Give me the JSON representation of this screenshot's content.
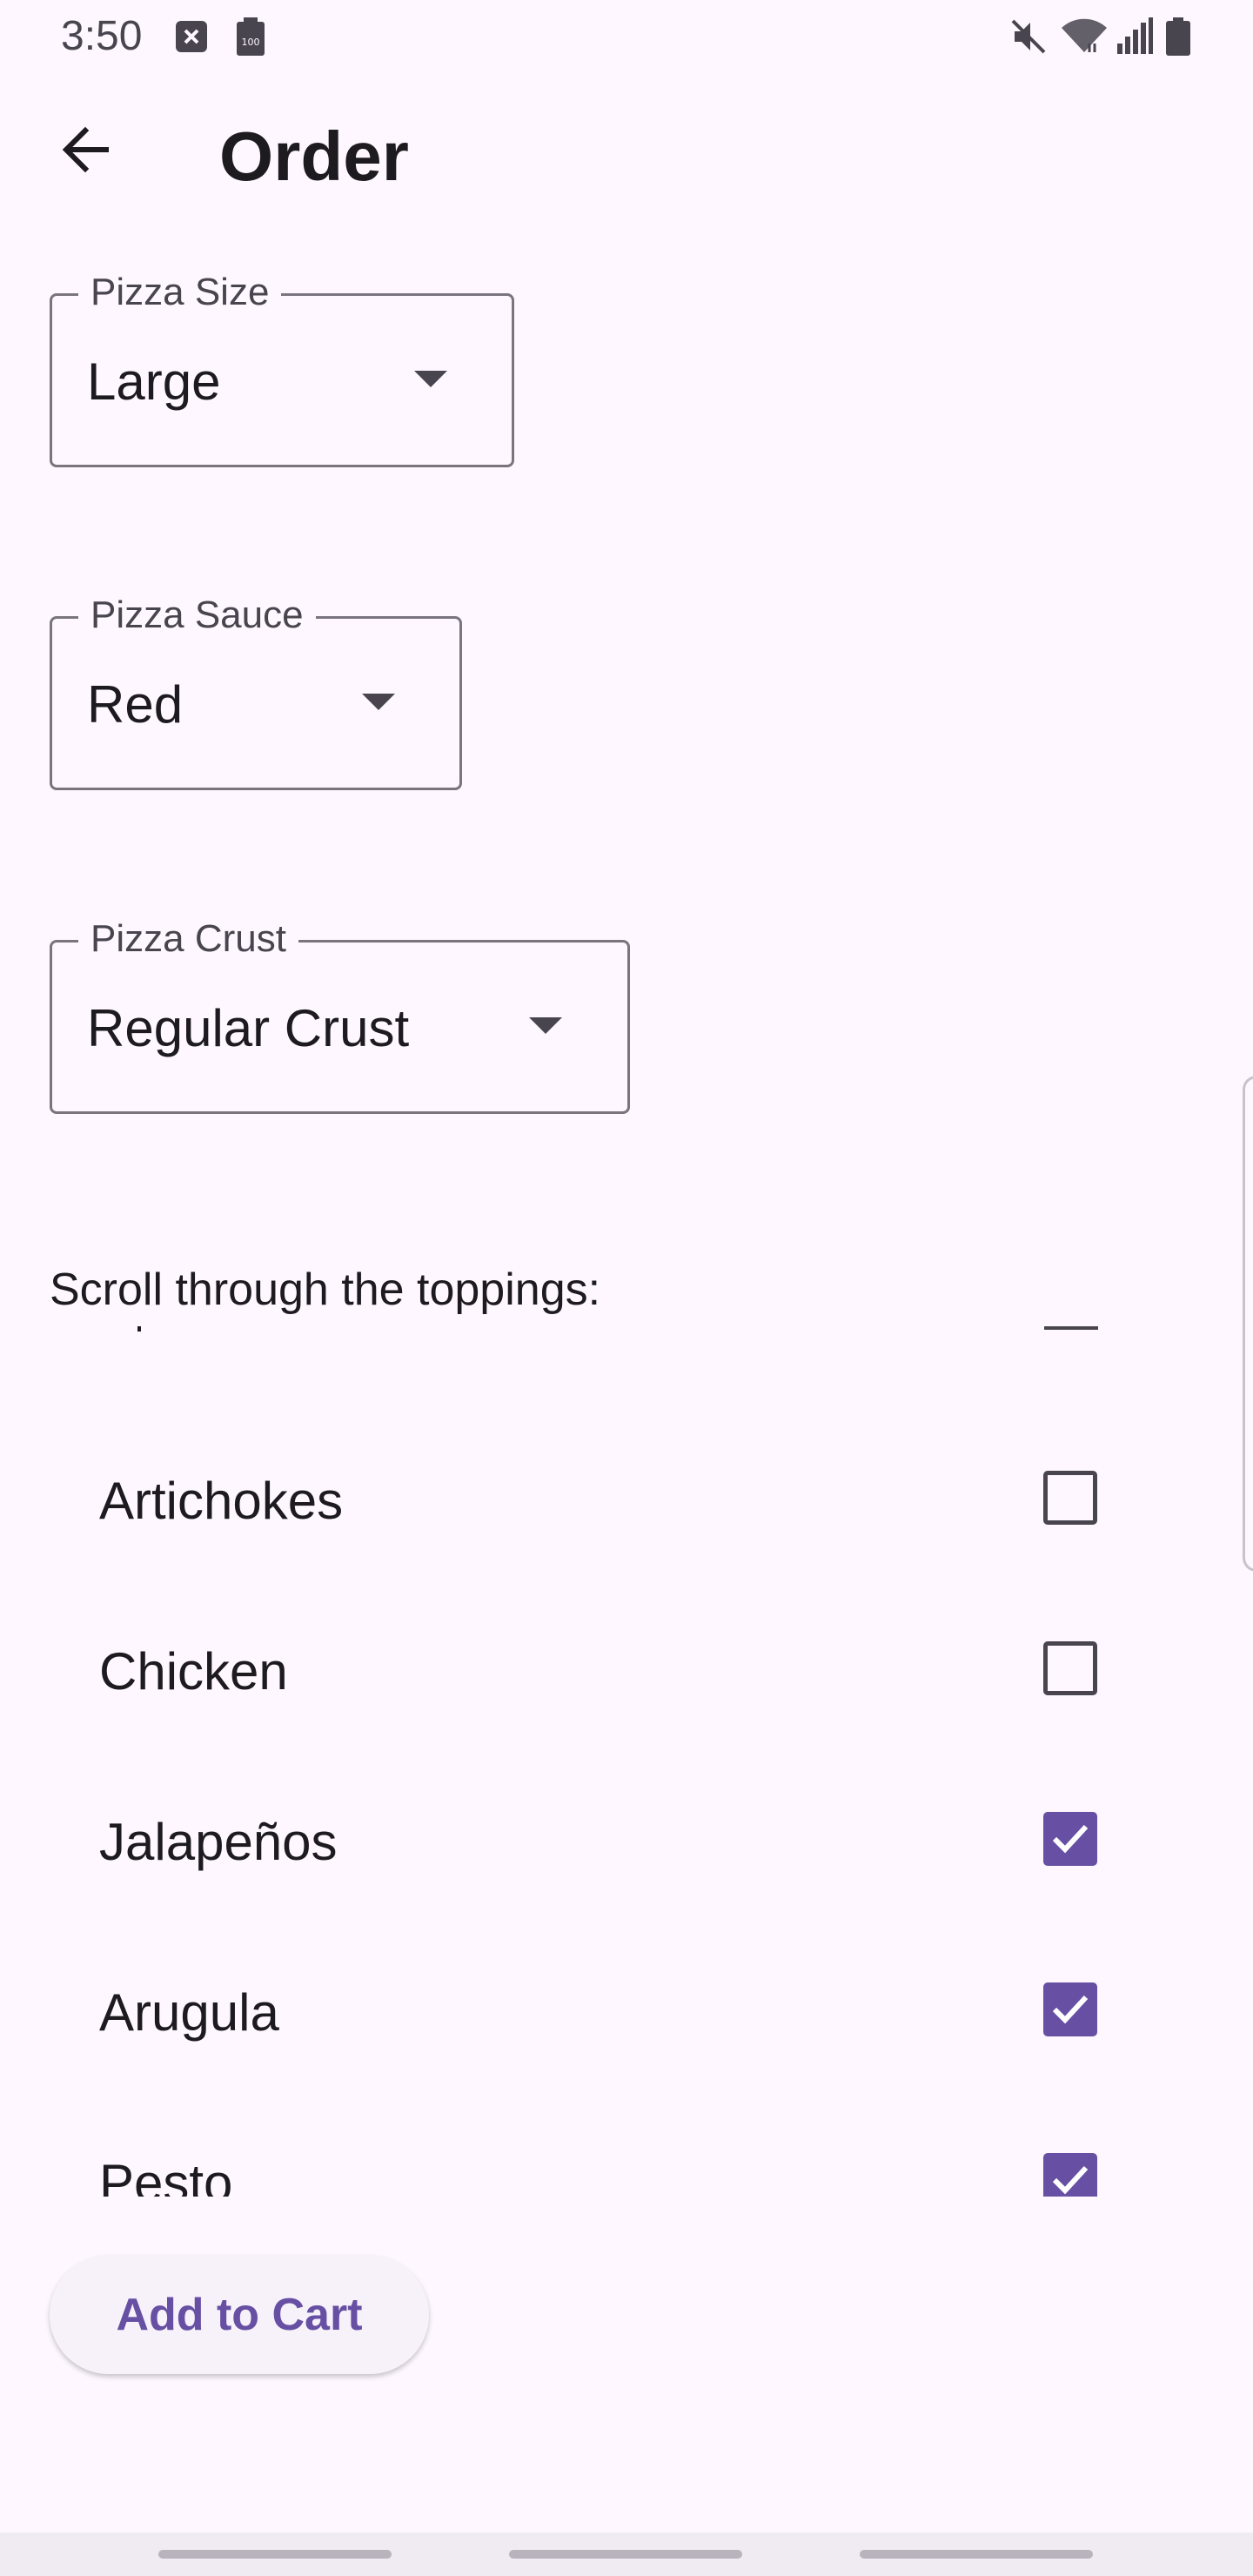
{
  "status_bar": {
    "time": "3:50",
    "left_icons": [
      "close-notification-icon",
      "battery-100-icon"
    ],
    "battery_badge": "100",
    "right_icons": [
      "mute-icon",
      "wifi-icon",
      "signal-icon",
      "battery-icon"
    ]
  },
  "app_bar": {
    "back_icon": "arrow-left-icon",
    "title": "Order"
  },
  "fields": {
    "size": {
      "label": "Pizza Size",
      "value": "Large"
    },
    "sauce": {
      "label": "Pizza Sauce",
      "value": "Red"
    },
    "crust": {
      "label": "Pizza Crust",
      "value": "Regular Crust"
    }
  },
  "toppings": {
    "heading": "Scroll through the toppings:",
    "items": [
      {
        "label": "Artichokes",
        "checked": false
      },
      {
        "label": "Chicken",
        "checked": false
      },
      {
        "label": "Jalapeños",
        "checked": true
      },
      {
        "label": "Arugula",
        "checked": true
      },
      {
        "label": "Pesto",
        "checked": true
      }
    ]
  },
  "cart_button": {
    "label": "Add to Cart"
  },
  "colors": {
    "background": "#FEF7FF",
    "primary": "#6750A4",
    "outline": "#79747E",
    "text": "#1D1B20"
  }
}
